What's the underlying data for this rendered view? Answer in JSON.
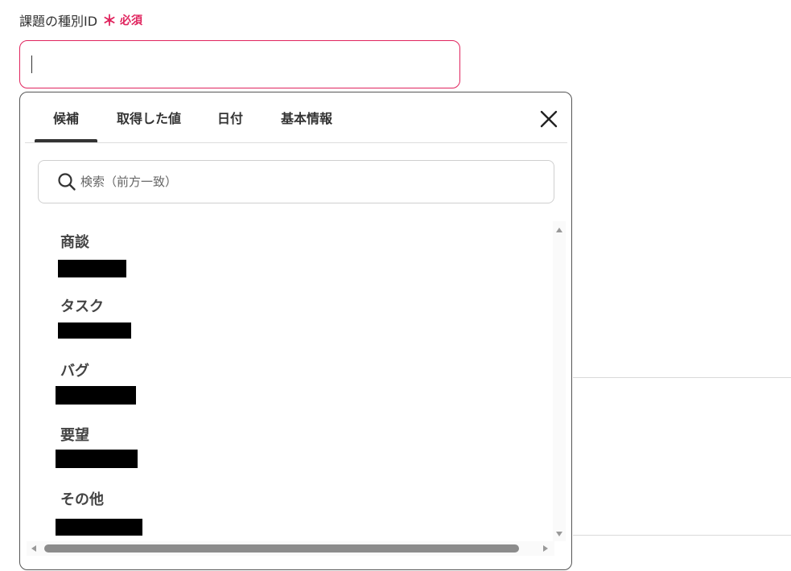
{
  "field": {
    "label": "課題の種別ID",
    "required_mark": "＊",
    "required_text": "必須",
    "value": ""
  },
  "popup": {
    "tabs": [
      {
        "label": "候補",
        "active": true
      },
      {
        "label": "取得した値",
        "active": false
      },
      {
        "label": "日付",
        "active": false
      },
      {
        "label": "基本情報",
        "active": false
      }
    ],
    "close_icon": "close-icon",
    "search": {
      "placeholder": "検索（前方一致）",
      "icon": "search-icon"
    },
    "items": [
      {
        "label": "商談"
      },
      {
        "label": "タスク"
      },
      {
        "label": "バグ"
      },
      {
        "label": "要望"
      },
      {
        "label": "その他"
      }
    ]
  },
  "colors": {
    "required": "#e0245e",
    "input_border": "#e0245e",
    "text": "#333333"
  }
}
